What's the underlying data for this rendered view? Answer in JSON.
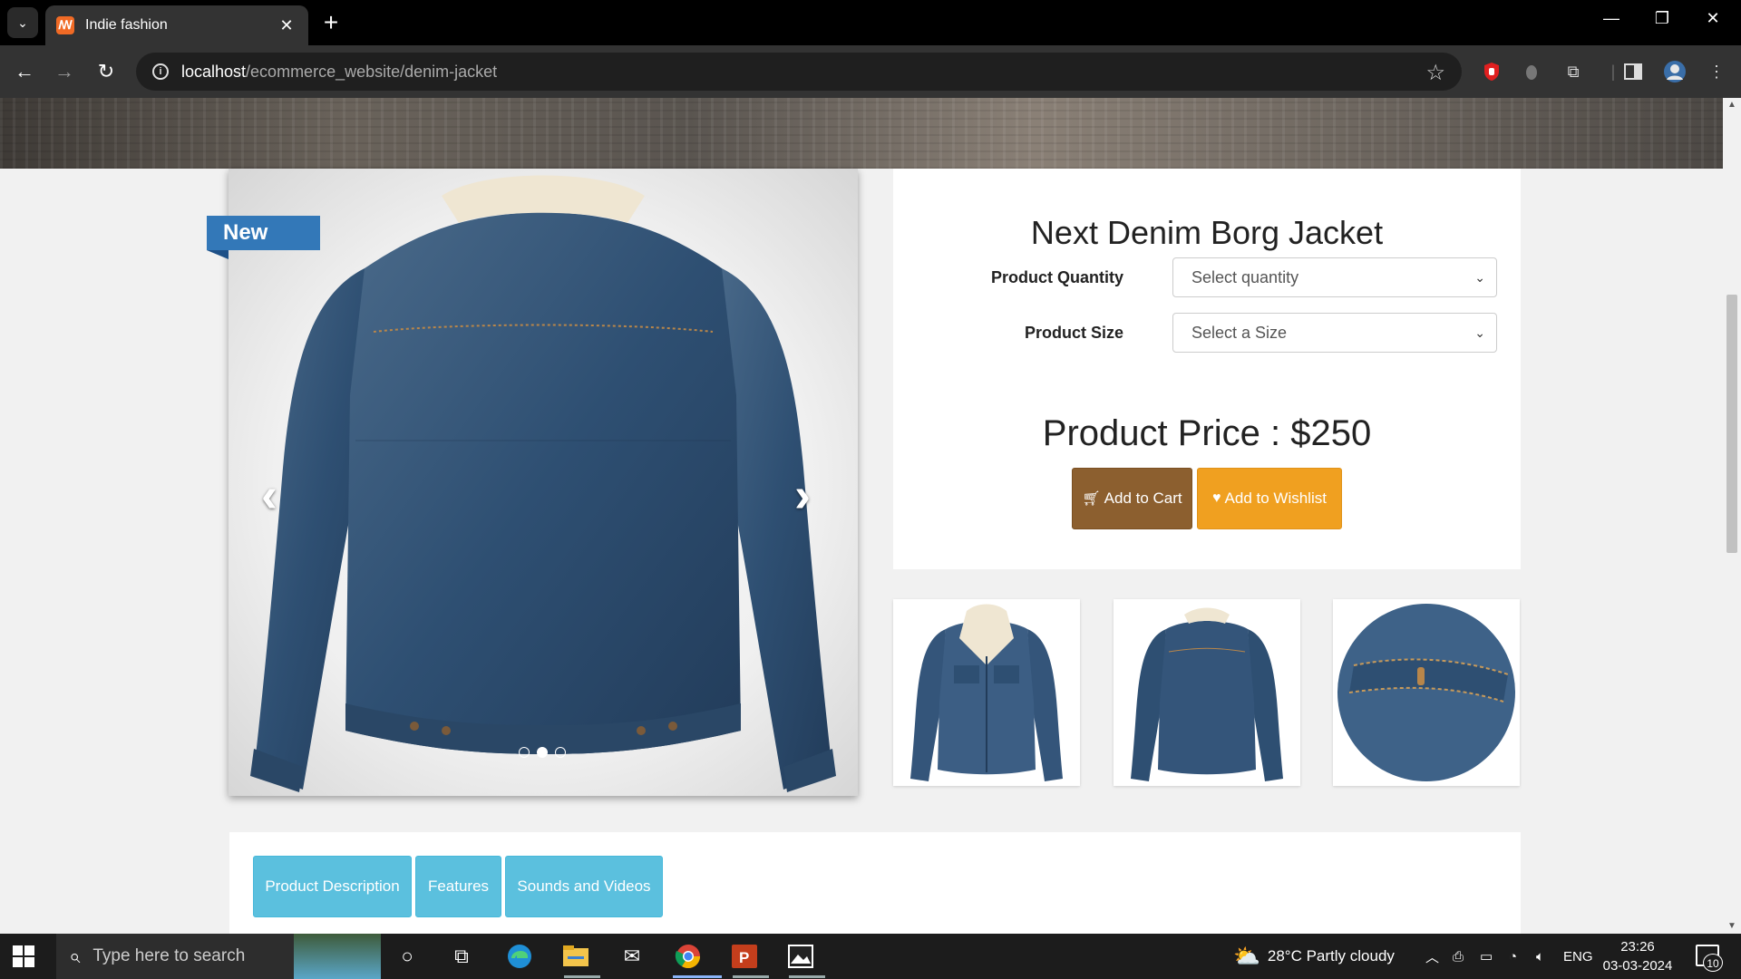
{
  "browser": {
    "tab_title": "Indie fashion",
    "tab_close": "✕",
    "new_tab": "+",
    "url_host": "localhost",
    "url_path": "/ecommerce_website/denim-jacket",
    "window_controls": {
      "minimize": "—",
      "restore": "❐",
      "close": "✕"
    }
  },
  "product": {
    "badge": "New",
    "name": "Next Denim Borg Jacket",
    "quantity_label": "Product Quantity",
    "quantity_value": "Select quantity",
    "size_label": "Product Size",
    "size_value": "Select a Size",
    "price_text": "Product Price : $250",
    "add_to_cart": "Add to Cart",
    "add_to_wishlist": "Add to Wishlist",
    "carousel": {
      "active_slide": 2,
      "slide_count": 3
    },
    "thumbnails": [
      "denim-jacket-front",
      "denim-jacket-back",
      "denim-pocket-detail"
    ]
  },
  "tabs": [
    {
      "label": "Product Description"
    },
    {
      "label": "Features"
    },
    {
      "label": "Sounds and Videos"
    }
  ],
  "taskbar": {
    "search_placeholder": "Type here to search",
    "weather": "28°C  Partly cloudy",
    "language": "ENG",
    "time": "23:26",
    "date": "03-03-2024",
    "notifications": "10"
  },
  "colors": {
    "cart_button": "#8c5f2f",
    "wishlist_button": "#f0a020",
    "tab_button": "#5bc0de",
    "new_badge": "#3378b8"
  }
}
